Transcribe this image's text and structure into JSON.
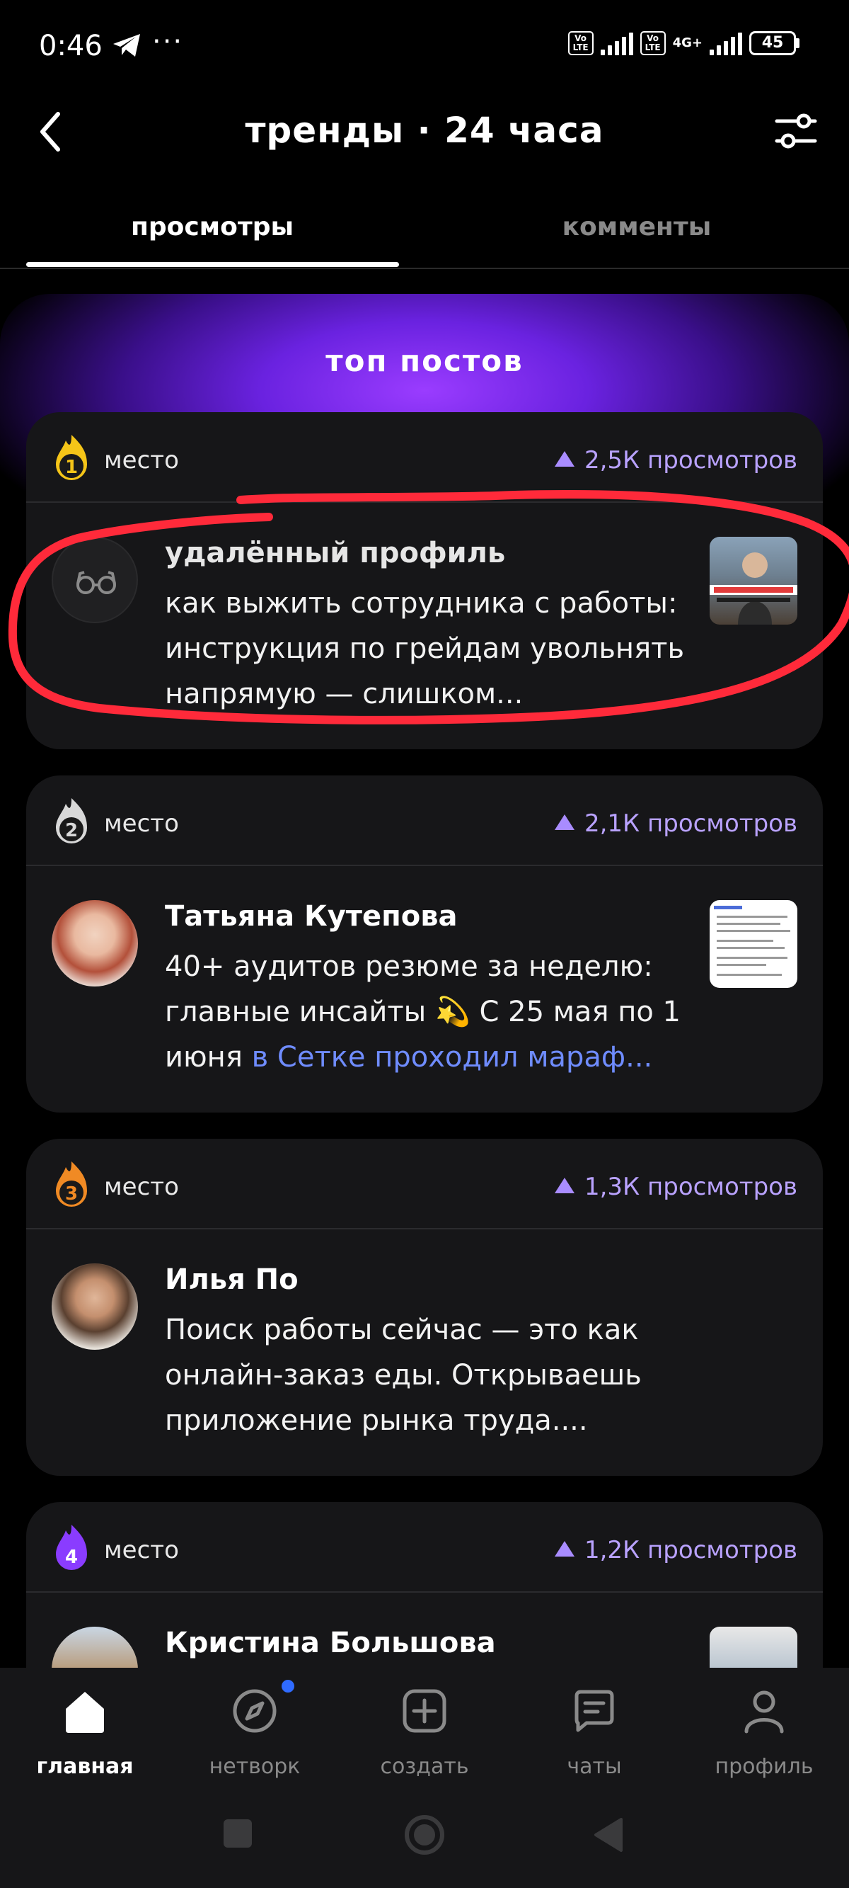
{
  "status_bar": {
    "time": "0:46",
    "dots": "···",
    "volte_1": "Vo LTE",
    "volte_2": "Vo LTE",
    "network": "4G+",
    "battery": "45"
  },
  "header": {
    "title": "тренды · 24 часа"
  },
  "tabs": [
    {
      "label": "просмотры",
      "active": true
    },
    {
      "label": "комменты",
      "active": false
    }
  ],
  "hero": {
    "title": "топ постов"
  },
  "posts": [
    {
      "rank": "1",
      "rank_label": "место",
      "views": "2,5К просмотров",
      "author": "удалённый профиль",
      "text": "как выжить сотрудника с работы: инструкция по грейдам увольнять напрямую — слишком...",
      "rank_color": "#f5c518"
    },
    {
      "rank": "2",
      "rank_label": "место",
      "views": "2,1К просмотров",
      "author": "Татьяна Кутепова",
      "text": "40+ аудитов резюме за неделю: главные инсайты 💫 С 25 мая по 1 июня",
      "link_text": "в Сетке проходил мараф...",
      "rank_color": "#d8d8d8"
    },
    {
      "rank": "3",
      "rank_label": "место",
      "views": "1,3К просмотров",
      "author": "Илья По",
      "text": "Поиск работы сейчас — это как онлайн-заказ еды. Открываешь приложение рынка труда....",
      "rank_color": "#f08a24"
    },
    {
      "rank": "4",
      "rank_label": "место",
      "views": "1,2К просмотров",
      "author": "Кристина Большова",
      "text": "",
      "rank_color": "#8a3cff"
    }
  ],
  "bottom_nav": [
    {
      "label": "главная",
      "icon": "home-icon",
      "active": true
    },
    {
      "label": "нетворк",
      "icon": "compass-icon",
      "active": false
    },
    {
      "label": "создать",
      "icon": "plus-square-icon",
      "active": false
    },
    {
      "label": "чаты",
      "icon": "chat-icon",
      "active": false
    },
    {
      "label": "профиль",
      "icon": "person-icon",
      "active": false
    }
  ],
  "colors": {
    "accent_purple": "#8a3cff",
    "views_purple": "#b9a2ff",
    "link_blue": "#6f8cff",
    "annotation_red": "#ff2a3a"
  }
}
